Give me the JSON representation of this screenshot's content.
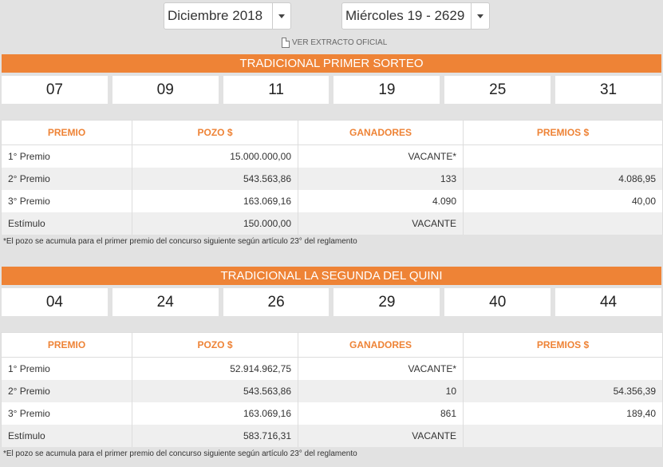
{
  "selectors": {
    "month": "Diciembre 2018",
    "draw": "Miércoles 19 - 2629"
  },
  "extract_link": "VER EXTRACTO OFICIAL",
  "headers": [
    "PREMIO",
    "POZO $",
    "GANADORES",
    "PREMIOS $"
  ],
  "sections": [
    {
      "title": "TRADICIONAL PRIMER SORTEO",
      "numbers": [
        "07",
        "09",
        "11",
        "19",
        "25",
        "31"
      ],
      "rows": [
        {
          "premio": "1° Premio",
          "pozo": "15.000.000,00",
          "ganadores": "VACANTE*",
          "premios": ""
        },
        {
          "premio": "2° Premio",
          "pozo": "543.563,86",
          "ganadores": "133",
          "premios": "4.086,95"
        },
        {
          "premio": "3° Premio",
          "pozo": "163.069,16",
          "ganadores": "4.090",
          "premios": "40,00"
        },
        {
          "premio": "Estímulo",
          "pozo": "150.000,00",
          "ganadores": "VACANTE",
          "premios": ""
        }
      ],
      "note": "*El pozo se acumula para el primer premio del concurso siguiente según artículo 23° del reglamento"
    },
    {
      "title": "TRADICIONAL LA SEGUNDA DEL QUINI",
      "numbers": [
        "04",
        "24",
        "26",
        "29",
        "40",
        "44"
      ],
      "rows": [
        {
          "premio": "1° Premio",
          "pozo": "52.914.962,75",
          "ganadores": "VACANTE*",
          "premios": ""
        },
        {
          "premio": "2° Premio",
          "pozo": "543.563,86",
          "ganadores": "10",
          "premios": "54.356,39"
        },
        {
          "premio": "3° Premio",
          "pozo": "163.069,16",
          "ganadores": "861",
          "premios": "189,40"
        },
        {
          "premio": "Estímulo",
          "pozo": "583.716,31",
          "ganadores": "VACANTE",
          "premios": ""
        }
      ],
      "note": "*El pozo se acumula para el primer premio del concurso siguiente según artículo 23° del reglamento"
    }
  ]
}
